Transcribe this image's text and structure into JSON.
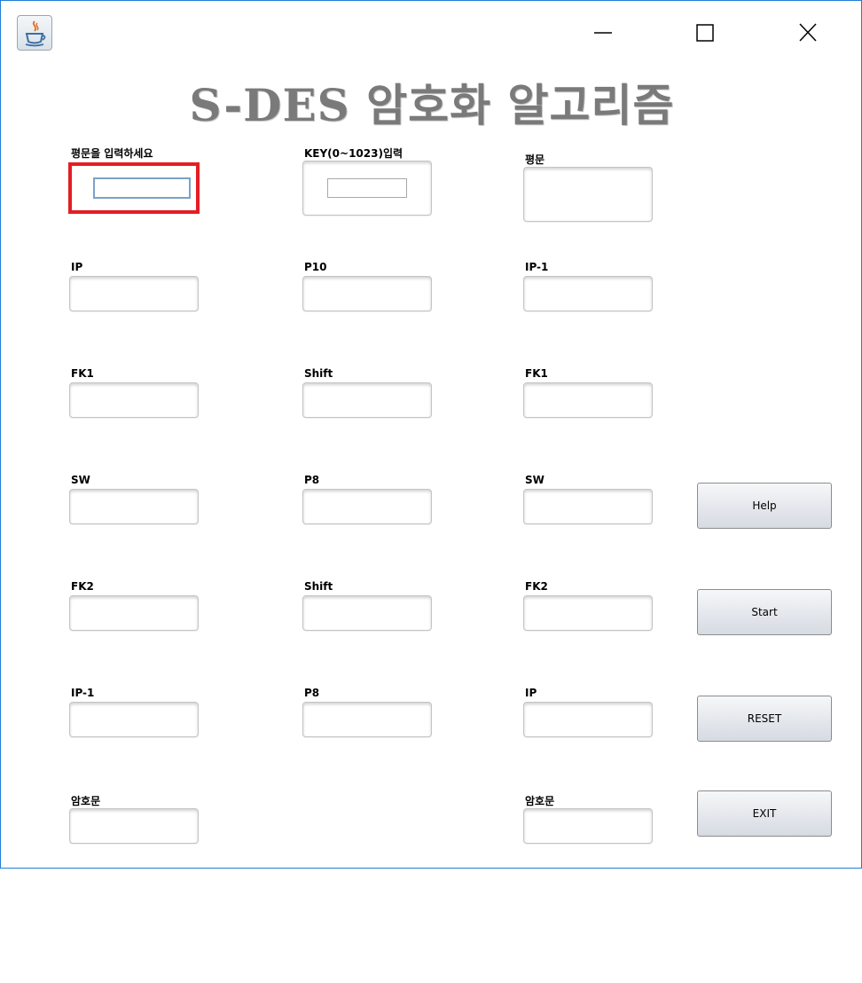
{
  "window": {
    "title_text": "S-DES 암호화 알고리즘",
    "icon": "java-cup-icon",
    "controls": [
      "minimize-icon",
      "maximize-icon",
      "close-icon"
    ]
  },
  "col1": {
    "plaintext_label": "평문을 입력하세요",
    "plaintext_value": "",
    "ip_label": "IP",
    "fk1_label": "FK1",
    "sw_label": "SW",
    "fk2_label": "FK2",
    "ip_inv_label": "IP-1",
    "ciphertext_label": "암호문"
  },
  "col2": {
    "key_label": "KEY(0~1023)입력",
    "key_value": "",
    "p10_label": "P10",
    "shift1_label": "Shift",
    "p8_1_label": "P8",
    "shift2_label": "Shift",
    "p8_2_label": "P8"
  },
  "col3": {
    "plaintext_label": "평문",
    "ip_inv_label": "IP-1",
    "fk1_label": "FK1",
    "sw_label": "SW",
    "fk2_label": "FK2",
    "ip_label": "IP",
    "ciphertext_label": "암호문"
  },
  "buttons": {
    "help": "Help",
    "start": "Start",
    "reset": "RESET",
    "exit": "EXIT"
  },
  "colors": {
    "window_border": "#1e7fd8",
    "highlight": "#e31e24",
    "title_text": "#7a7a7a"
  }
}
